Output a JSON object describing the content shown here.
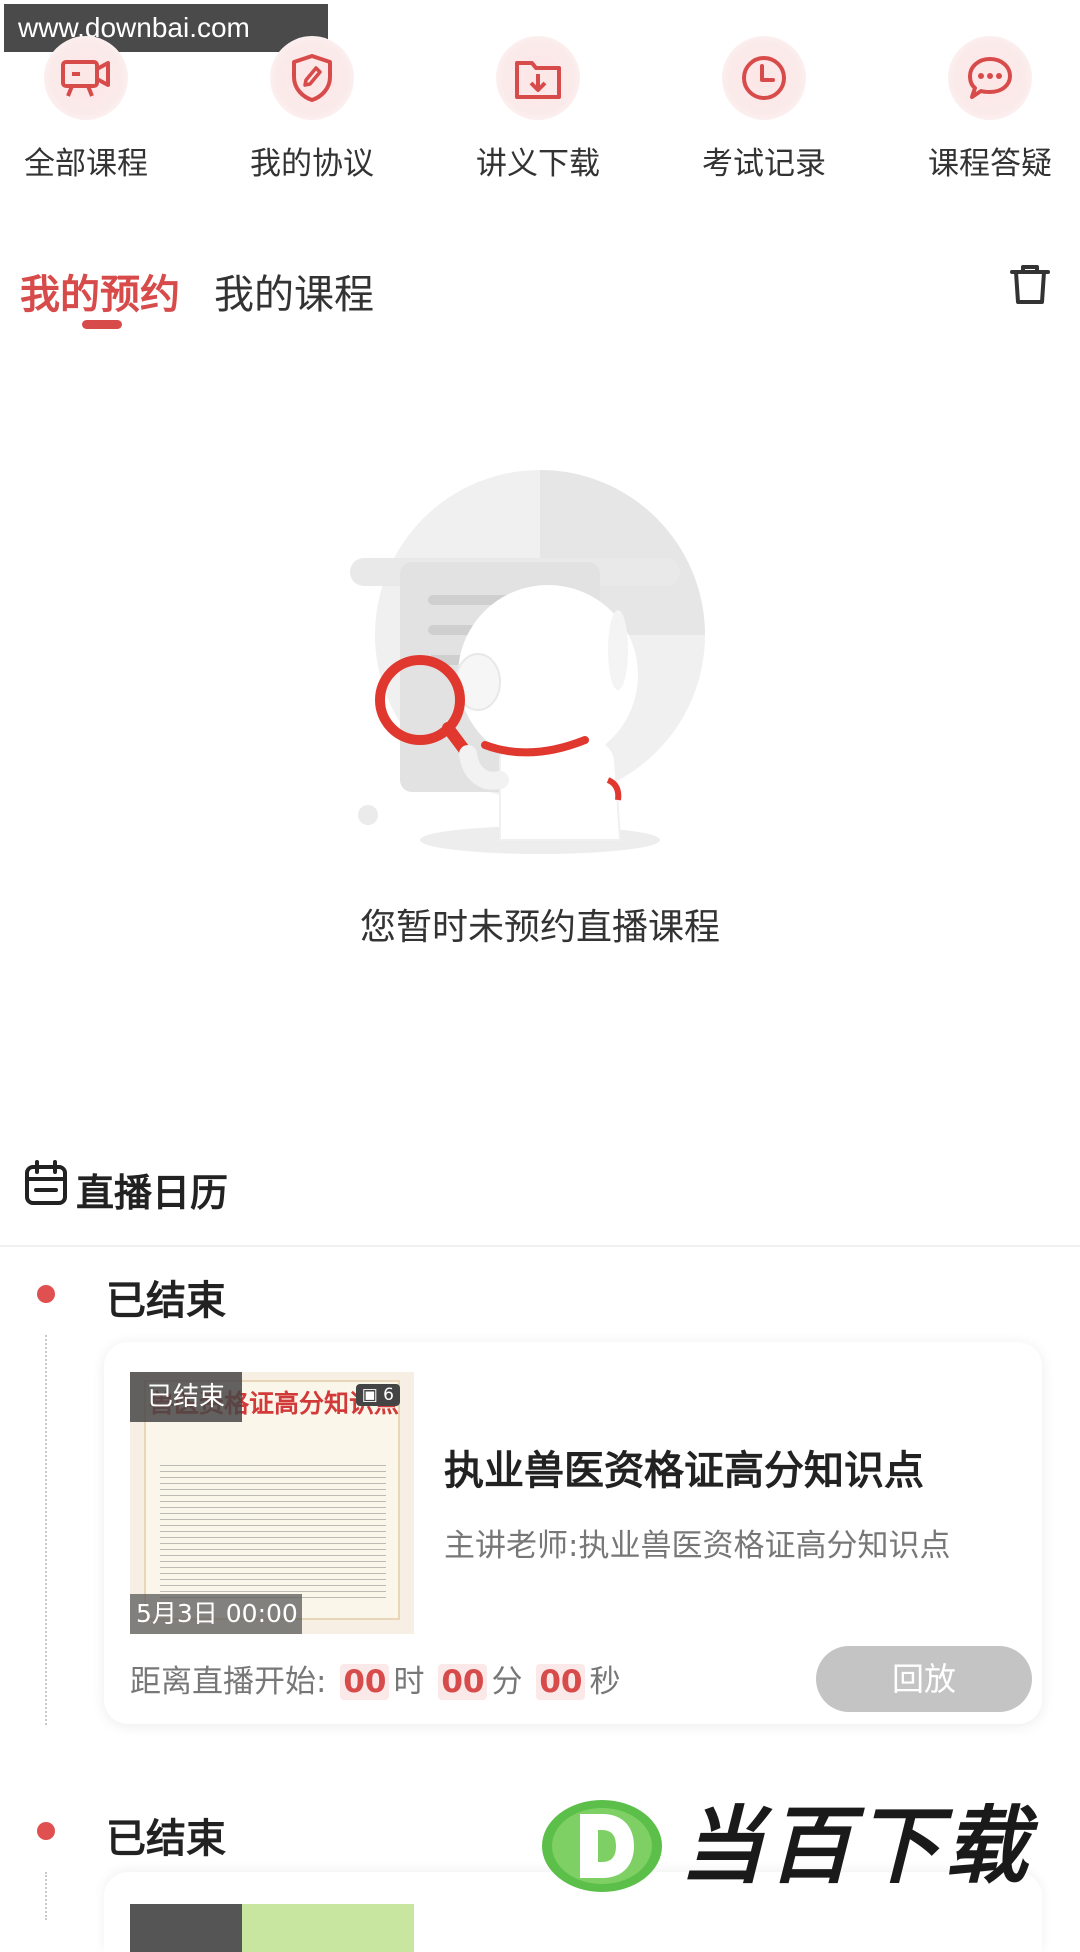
{
  "watermark": {
    "url": "www.downbai.com",
    "brand": "当百下载"
  },
  "quick_actions": [
    {
      "label": "全部课程",
      "icon": "video-course-icon"
    },
    {
      "label": "我的协议",
      "icon": "shield-pen-icon"
    },
    {
      "label": "讲义下载",
      "icon": "folder-download-icon"
    },
    {
      "label": "考试记录",
      "icon": "clock-icon"
    },
    {
      "label": "课程答疑",
      "icon": "chat-bubble-icon"
    }
  ],
  "tabs": [
    {
      "label": "我的预约",
      "active": true
    },
    {
      "label": "我的课程",
      "active": false
    }
  ],
  "empty_state": {
    "message": "您暂时未预约直播课程"
  },
  "calendar": {
    "title": "直播日历",
    "sections": [
      {
        "status": "已结束",
        "card": {
          "badge": "已结束",
          "image_count": "6",
          "thumb_title": "兽医资格证高分知识点",
          "date": "5月3日 00:00",
          "title": "执业兽医资格证高分知识点",
          "teacher": "主讲老师:执业兽医资格证高分知识点",
          "countdown_label": "距离直播开始:",
          "hours": "00",
          "hours_unit": "时",
          "minutes": "00",
          "minutes_unit": "分",
          "seconds": "00",
          "seconds_unit": "秒",
          "button": "回放"
        }
      },
      {
        "status": "已结束"
      }
    ]
  },
  "colors": {
    "accent": "#d84b4b",
    "text": "#222222",
    "muted": "#777777",
    "button_disabled": "#c4c4c4"
  }
}
